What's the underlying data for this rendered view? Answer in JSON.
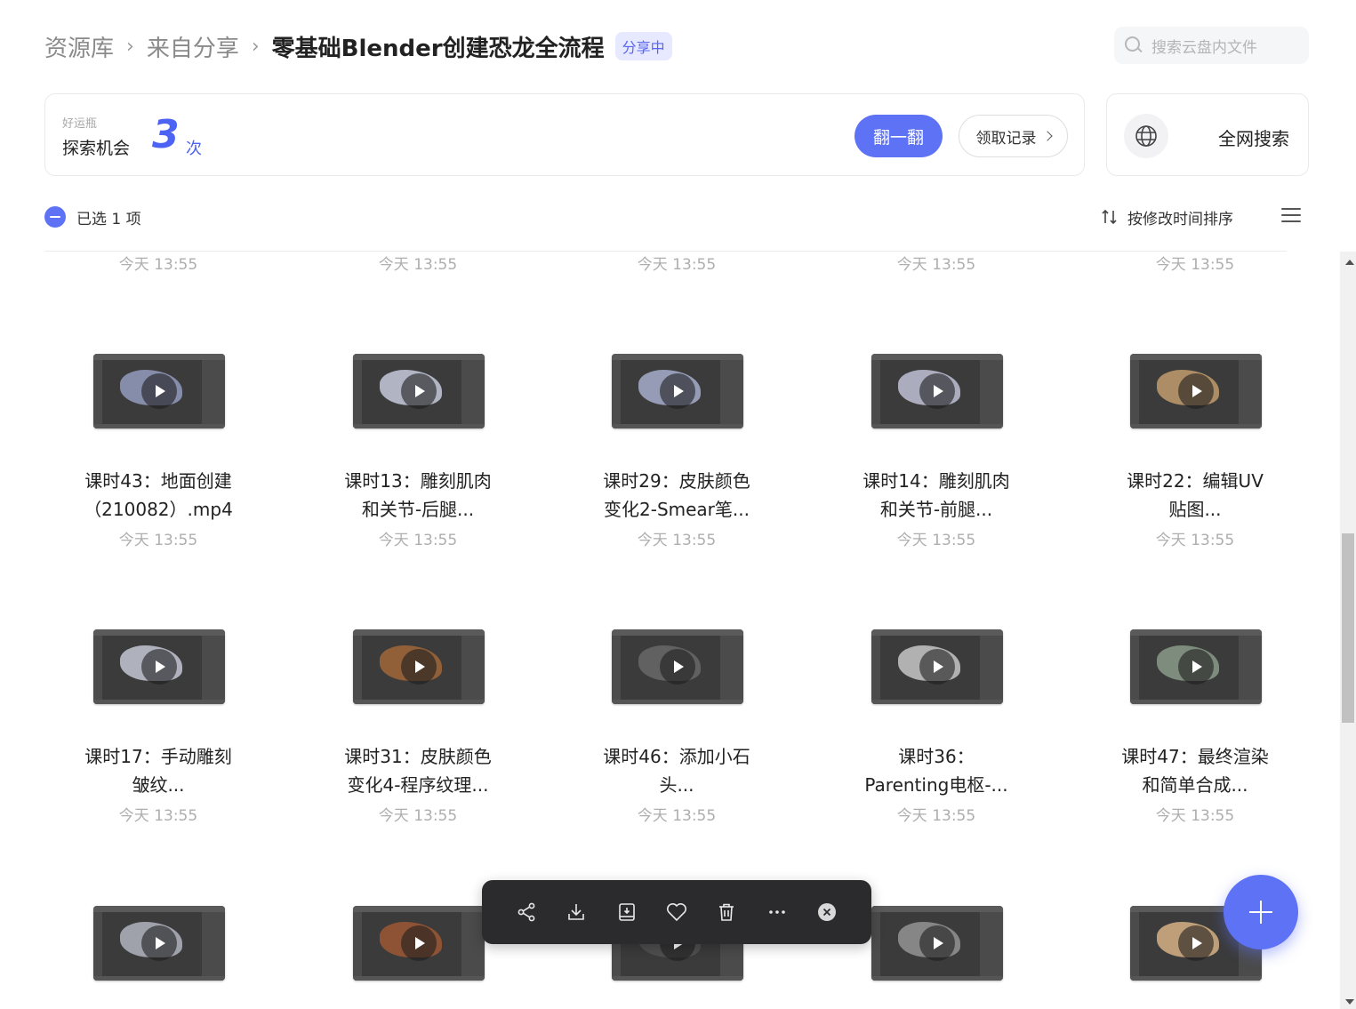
{
  "breadcrumb": {
    "items": [
      "资源库",
      "来自分享"
    ],
    "separator": "›",
    "current": "零基础Blender创建恐龙全流程",
    "tag": "分享中"
  },
  "search": {
    "placeholder": "搜索云盘内文件",
    "icon": "search-icon"
  },
  "lucky": {
    "label_small": "好运瓶",
    "label_main": "探索机会",
    "count": "3",
    "unit": "次",
    "flip_label": "翻一翻",
    "record_label": "领取记录"
  },
  "web_search": {
    "label": "全网搜索",
    "icon": "globe-icon"
  },
  "selection": {
    "text": "已选 1 项"
  },
  "sort": {
    "label": "按修改时间排序",
    "icon": "sort-icon"
  },
  "view_toggle_icon": "list-icon",
  "top_row_dates": [
    "今天 13:55",
    "今天 13:55",
    "今天 13:55",
    "今天 13:55",
    "今天 13:55"
  ],
  "files": [
    {
      "line1": "课时43：地面创建",
      "line2": "（210082）.mp4",
      "date": "今天 13:55"
    },
    {
      "line1": "课时13：雕刻肌肉",
      "line2": "和关节-后腿...",
      "date": "今天 13:55"
    },
    {
      "line1": "课时29：皮肤颜色",
      "line2": "变化2-Smear笔...",
      "date": "今天 13:55"
    },
    {
      "line1": "课时14：雕刻肌肉",
      "line2": "和关节-前腿...",
      "date": "今天 13:55"
    },
    {
      "line1": "课时22：编辑UV",
      "line2": "贴图...",
      "date": "今天 13:55"
    },
    {
      "line1": "课时17：手动雕刻",
      "line2": "皱纹...",
      "date": "今天 13:55"
    },
    {
      "line1": "课时31：皮肤颜色",
      "line2": "变化4-程序纹理...",
      "date": "今天 13:55"
    },
    {
      "line1": "课时46：添加小石",
      "line2": "头...",
      "date": "今天 13:55"
    },
    {
      "line1": "课时36：",
      "line2": "Parenting电枢-...",
      "date": "今天 13:55"
    },
    {
      "line1": "课时47：最终渲染",
      "line2": "和简单合成...",
      "date": "今天 13:55"
    }
  ],
  "bottom_row_count": 5,
  "toolbar": {
    "buttons": [
      "share-icon",
      "download-icon",
      "save-to-drive-icon",
      "favorite-icon",
      "delete-icon",
      "more-icon",
      "close-icon"
    ]
  },
  "fab_icon": "plus-icon",
  "colors": {
    "accent": "#5e72f6",
    "toolbar_bg": "#2b2b2e",
    "tag_bg": "#e6e9ff"
  }
}
